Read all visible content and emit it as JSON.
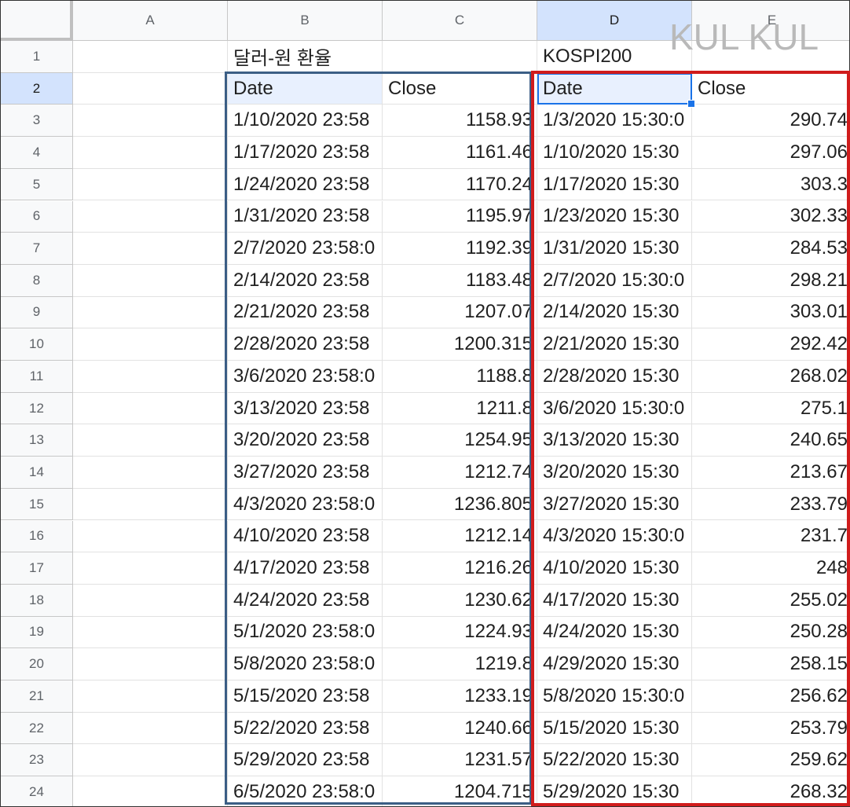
{
  "sheet": {
    "columns": [
      "A",
      "B",
      "C",
      "D",
      "E"
    ],
    "rows": [
      "1",
      "2",
      "3",
      "4",
      "5",
      "6",
      "7",
      "8",
      "9",
      "10",
      "11",
      "12",
      "13",
      "14",
      "15",
      "16",
      "17",
      "18",
      "19",
      "20",
      "21",
      "22",
      "23",
      "24"
    ],
    "titles": {
      "fx": "달러-원 환율",
      "kospi": "KOSPI200"
    },
    "headers": {
      "fx_date": "Date",
      "fx_close": "Close",
      "kospi_date": "Date",
      "kospi_close": "Close"
    },
    "fx_data": [
      [
        "1/10/2020 23:58",
        "1158.93"
      ],
      [
        "1/17/2020 23:58",
        "1161.46"
      ],
      [
        "1/24/2020 23:58",
        "1170.24"
      ],
      [
        "1/31/2020 23:58",
        "1195.97"
      ],
      [
        "2/7/2020 23:58:0",
        "1192.39"
      ],
      [
        "2/14/2020 23:58",
        "1183.48"
      ],
      [
        "2/21/2020 23:58",
        "1207.07"
      ],
      [
        "2/28/2020 23:58",
        "1200.315"
      ],
      [
        "3/6/2020 23:58:0",
        "1188.8"
      ],
      [
        "3/13/2020 23:58",
        "1211.8"
      ],
      [
        "3/20/2020 23:58",
        "1254.95"
      ],
      [
        "3/27/2020 23:58",
        "1212.74"
      ],
      [
        "4/3/2020 23:58:0",
        "1236.805"
      ],
      [
        "4/10/2020 23:58",
        "1212.14"
      ],
      [
        "4/17/2020 23:58",
        "1216.26"
      ],
      [
        "4/24/2020 23:58",
        "1230.62"
      ],
      [
        "5/1/2020 23:58:0",
        "1224.93"
      ],
      [
        "5/8/2020 23:58:0",
        "1219.8"
      ],
      [
        "5/15/2020 23:58",
        "1233.19"
      ],
      [
        "5/22/2020 23:58",
        "1240.66"
      ],
      [
        "5/29/2020 23:58",
        "1231.57"
      ],
      [
        "6/5/2020 23:58:0",
        "1204.715"
      ]
    ],
    "kospi_data": [
      [
        "1/3/2020 15:30:0",
        "290.74"
      ],
      [
        "1/10/2020 15:30",
        "297.06"
      ],
      [
        "1/17/2020 15:30",
        "303.3"
      ],
      [
        "1/23/2020 15:30",
        "302.33"
      ],
      [
        "1/31/2020 15:30",
        "284.53"
      ],
      [
        "2/7/2020 15:30:0",
        "298.21"
      ],
      [
        "2/14/2020 15:30",
        "303.01"
      ],
      [
        "2/21/2020 15:30",
        "292.42"
      ],
      [
        "2/28/2020 15:30",
        "268.02"
      ],
      [
        "3/6/2020 15:30:0",
        "275.1"
      ],
      [
        "3/13/2020 15:30",
        "240.65"
      ],
      [
        "3/20/2020 15:30",
        "213.67"
      ],
      [
        "3/27/2020 15:30",
        "233.79"
      ],
      [
        "4/3/2020 15:30:0",
        "231.7"
      ],
      [
        "4/10/2020 15:30",
        "248"
      ],
      [
        "4/17/2020 15:30",
        "255.02"
      ],
      [
        "4/24/2020 15:30",
        "250.28"
      ],
      [
        "4/29/2020 15:30",
        "258.15"
      ],
      [
        "5/8/2020 15:30:0",
        "256.62"
      ],
      [
        "5/15/2020 15:30",
        "253.79"
      ],
      [
        "5/22/2020 15:30",
        "259.62"
      ],
      [
        "5/29/2020 15:30",
        "268.32"
      ]
    ],
    "selected_cell": "D2"
  },
  "watermark": "KUL KUL",
  "colors": {
    "selection": "#1a73e8",
    "fx_box": "#3b5e85",
    "kospi_box": "#d01c1c"
  }
}
